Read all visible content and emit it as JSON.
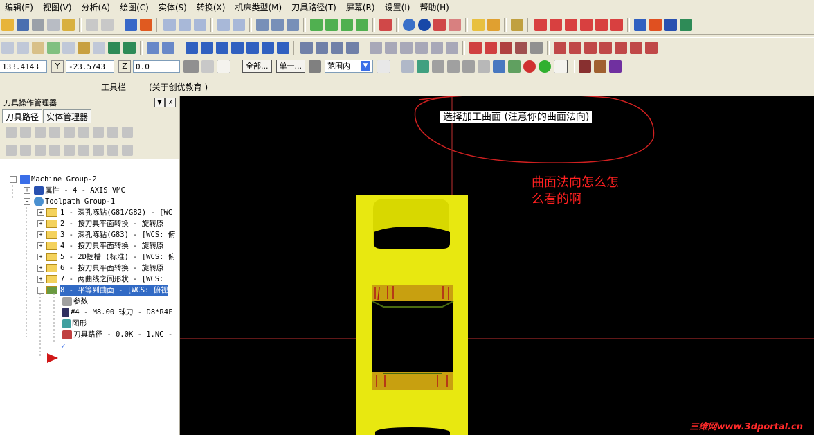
{
  "menu": [
    "编辑(E)",
    "视图(V)",
    "分析(A)",
    "绘图(C)",
    "实体(S)",
    "转换(X)",
    "机床类型(M)",
    "刀具路径(T)",
    "屏幕(R)",
    "设置(I)",
    "帮助(H)"
  ],
  "coords": {
    "x_value": "133.4143",
    "y_label": "Y",
    "y_value": "-23.5743",
    "z_label": "Z",
    "z_value": "0.0",
    "btn_all": "全部...",
    "btn_single": "单一...",
    "range_value": "范围内"
  },
  "textbar": {
    "toolbar_label": "工具栏",
    "about_label": "(关于创优教育 )"
  },
  "panel": {
    "title": "刀具操作管理器",
    "tabs": [
      "刀具路径",
      "实体管理器"
    ],
    "tree": {
      "machine_group": "Machine Group-2",
      "properties": "属性 - 4 - AXIS VMC",
      "toolpath_group": "Toolpath Group-1",
      "ops": [
        "1 - 深孔啄钻(G81/G82) - [WC",
        "2 - 按刀具平面转换 - 旋转原",
        "3 - 深孔啄钻(G83) - [WCS: 俯",
        "4 - 按刀具平面转换 - 旋转原",
        "5 - 2D挖槽 (标准) - [WCS: 俯",
        "6 - 按刀具平面转换 - 旋转原",
        "7 - 两曲线之间形状 - [WCS:",
        "8 - 平等到曲面 - [WCS: 俯视"
      ],
      "sub": {
        "params": "参数",
        "tool": "#4 - M8.00 球刀 - D8*R4F",
        "geometry": "图形",
        "toolpath": "刀具路径 - 0.0K - 1.NC -"
      }
    }
  },
  "viewport": {
    "prompt": "选择加工曲面 (注意你的曲面法向)",
    "annotation_line1": "曲面法向怎么怎",
    "annotation_line2": "么看的啊",
    "watermark": "三维网www.3dportal.cn",
    "part_color": "#e8e810",
    "annotation_color": "#ff2020"
  }
}
